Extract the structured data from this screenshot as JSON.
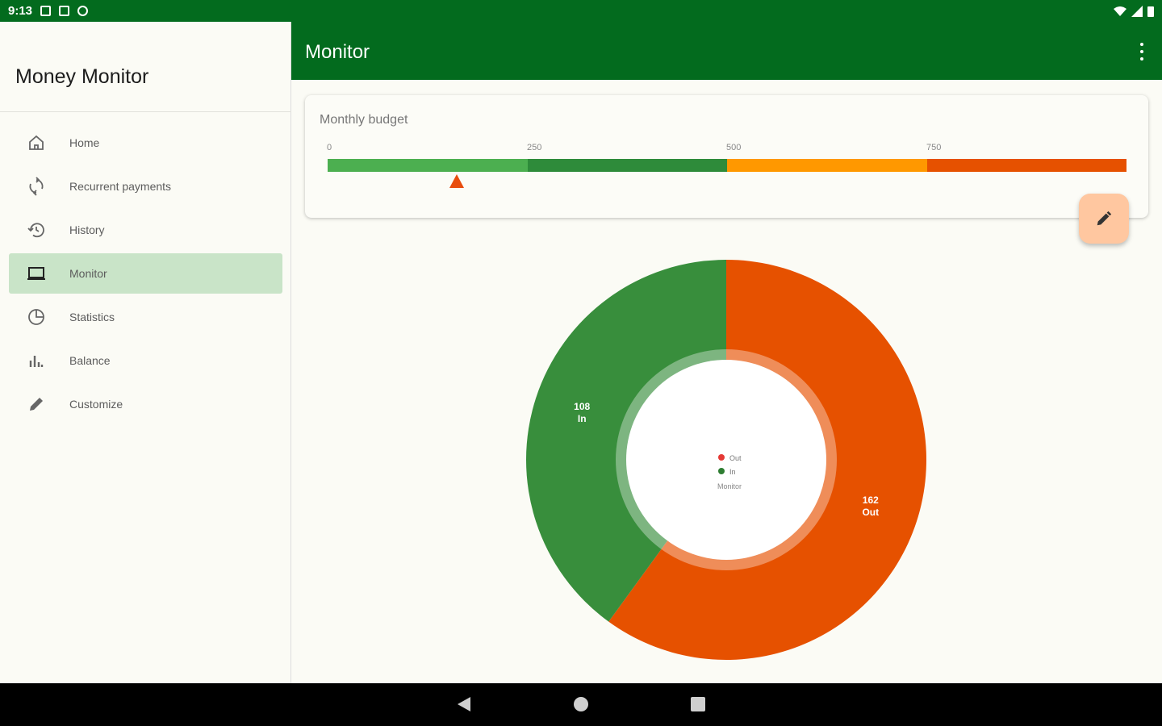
{
  "status_bar": {
    "time": "9:13"
  },
  "drawer": {
    "title": "Money Monitor",
    "items": [
      {
        "label": "Home",
        "icon": "home-icon",
        "active": false
      },
      {
        "label": "Recurrent payments",
        "icon": "recurrent-icon",
        "active": false
      },
      {
        "label": "History",
        "icon": "history-icon",
        "active": false
      },
      {
        "label": "Monitor",
        "icon": "monitor-icon",
        "active": true
      },
      {
        "label": "Statistics",
        "icon": "statistics-icon",
        "active": false
      },
      {
        "label": "Balance",
        "icon": "balance-icon",
        "active": false
      },
      {
        "label": "Customize",
        "icon": "pencil-icon",
        "active": false
      }
    ]
  },
  "app_bar": {
    "title": "Monitor"
  },
  "budget": {
    "title": "Monthly budget",
    "ticks": [
      "0",
      "250",
      "500",
      "750"
    ],
    "max": 1000,
    "marker_value": 162,
    "segments": [
      {
        "from": 0,
        "to": 250,
        "color": "#4caf50"
      },
      {
        "from": 250,
        "to": 500,
        "color": "#2e8b3a"
      },
      {
        "from": 500,
        "to": 750,
        "color": "#ff9800"
      },
      {
        "from": 750,
        "to": 1000,
        "color": "#e65100"
      }
    ]
  },
  "chart_data": {
    "type": "pie",
    "title": "",
    "center_label": "Monitor",
    "slices": [
      {
        "name": "Out",
        "value": 162,
        "label": "162\nOut",
        "color": "#e65100"
      },
      {
        "name": "In",
        "value": 108,
        "label": "108\nIn",
        "color": "#388e3c"
      }
    ],
    "legend": [
      {
        "name": "Out",
        "color": "#e53935"
      },
      {
        "name": "In",
        "color": "#2e7d32"
      }
    ]
  },
  "colors": {
    "primary": "#036b1e",
    "fab": "#ffc7a0",
    "active_nav": "#c9e4c8"
  }
}
